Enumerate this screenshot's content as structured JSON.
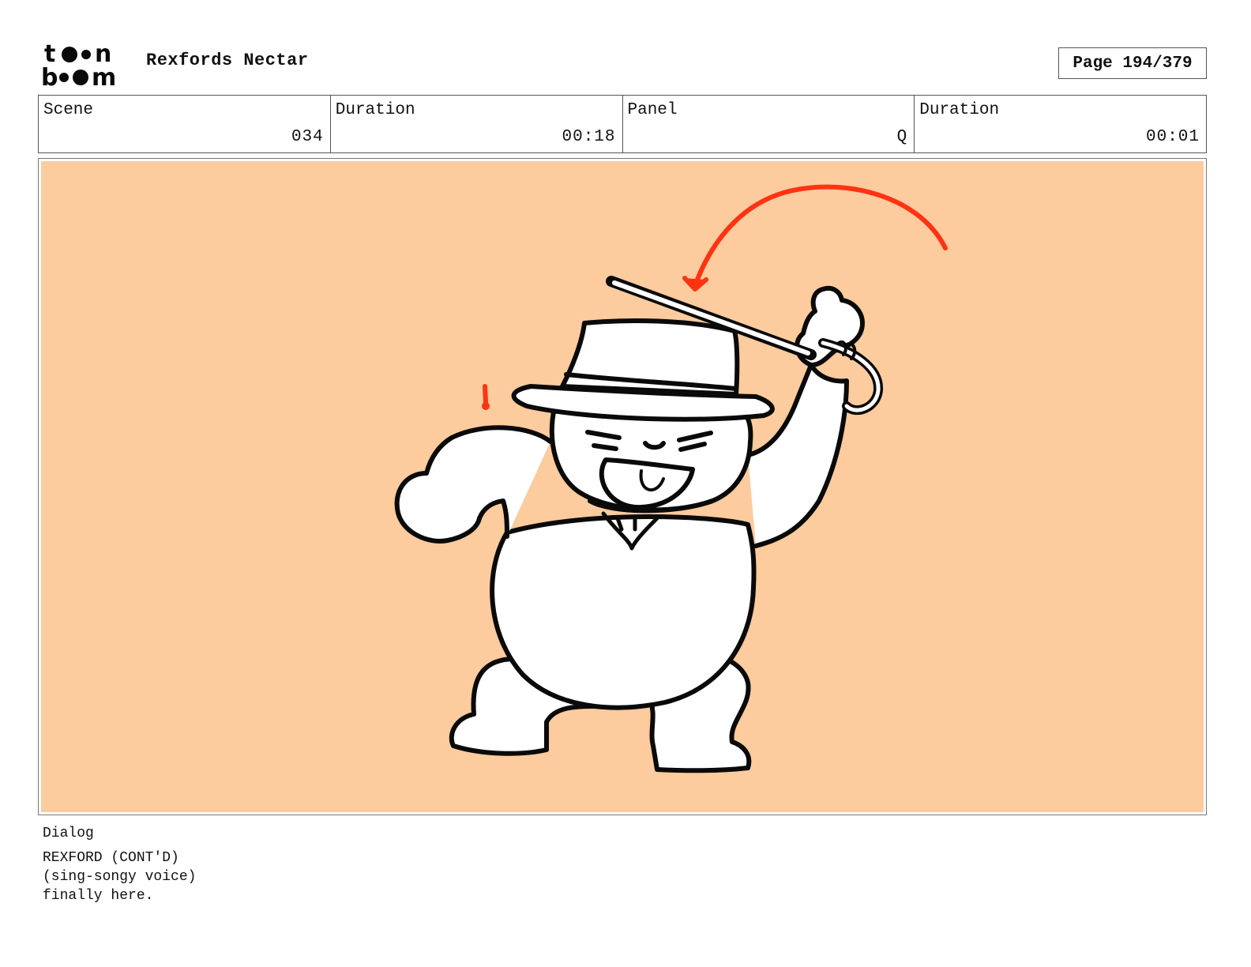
{
  "header": {
    "logo_text": "toon boom",
    "project_title": "Rexfords Nectar",
    "page_label": "Page 194/379"
  },
  "info": {
    "scene_label": "Scene",
    "scene_value": "034",
    "scene_duration_label": "Duration",
    "scene_duration_value": "00:18",
    "panel_label": "Panel",
    "panel_value": "Q",
    "panel_duration_label": "Duration",
    "panel_duration_value": "00:01"
  },
  "panel": {
    "background_color": "#FCCB9E",
    "line_color": "#0a0a0a",
    "accent_color": "#FF3311"
  },
  "dialog": {
    "label": "Dialog",
    "lines": [
      "REXFORD (CONT'D)",
      "(sing-songy voice)",
      "finally here."
    ]
  }
}
